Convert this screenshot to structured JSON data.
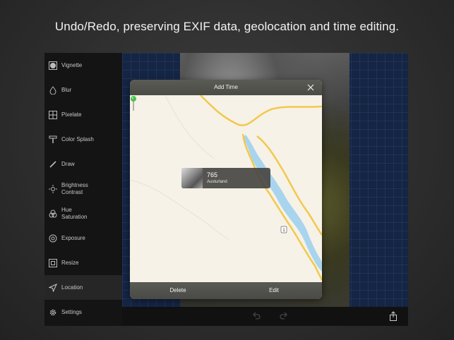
{
  "caption": "Undo/Redo, preserving EXIF data, geolocation and time editing.",
  "sidebar": {
    "items": [
      {
        "label": "Vignette",
        "icon": "vignette-icon"
      },
      {
        "label": "Blur",
        "icon": "blur-drop-icon"
      },
      {
        "label": "Pixelate",
        "icon": "pixelate-grid-icon"
      },
      {
        "label": "Color Splash",
        "icon": "color-splash-brush-icon"
      },
      {
        "label": "Draw",
        "icon": "pencil-icon"
      },
      {
        "label": "Brightness\nContrast",
        "icon": "sun-icon"
      },
      {
        "label": "Hue\nSaturation",
        "icon": "color-circles-icon"
      },
      {
        "label": "Exposure",
        "icon": "aperture-icon"
      },
      {
        "label": "Resize",
        "icon": "resize-icon"
      },
      {
        "label": "Location",
        "icon": "location-arrow-icon",
        "active": true
      },
      {
        "label": "Settings",
        "icon": "gear-icon"
      }
    ]
  },
  "dialog": {
    "title": "Add Time",
    "callout": {
      "title": "765",
      "subtitle": "Austurland"
    },
    "road_shield": "1",
    "delete_label": "Delete",
    "edit_label": "Edit"
  },
  "toolbar": {
    "icons": [
      "undo-icon",
      "redo-icon",
      "share-icon"
    ]
  },
  "colors": {
    "water": "#a9d4ee",
    "road": "#f2c94c",
    "map_bg": "#f6f2e8",
    "pin": "#4cc24a"
  }
}
